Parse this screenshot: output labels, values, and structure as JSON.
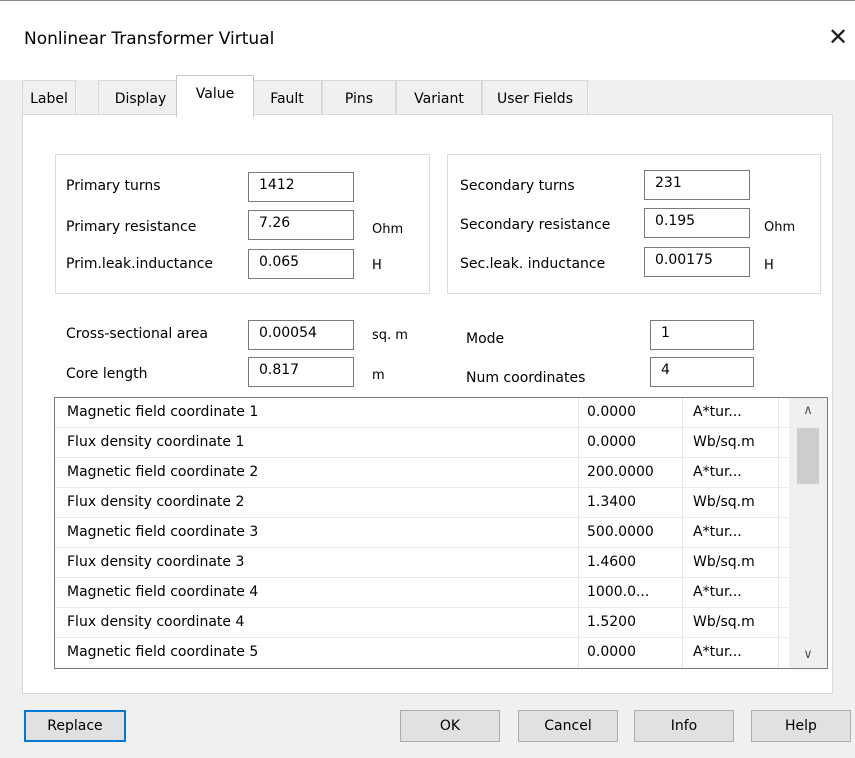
{
  "window": {
    "title": "Nonlinear Transformer Virtual",
    "close_glyph": "✕"
  },
  "tabs": [
    {
      "label": "Label"
    },
    {
      "label": "Display"
    },
    {
      "label": "Value"
    },
    {
      "label": "Fault"
    },
    {
      "label": "Pins"
    },
    {
      "label": "Variant"
    },
    {
      "label": "User Fields"
    }
  ],
  "active_tab": "Value",
  "primary": {
    "turns_label": "Primary turns",
    "turns_value": "1412",
    "resistance_label": "Primary resistance",
    "resistance_value": "7.26",
    "resistance_unit": "Ohm",
    "leak_label": "Prim.leak.inductance",
    "leak_value": "0.065",
    "leak_unit": "H"
  },
  "secondary": {
    "turns_label": "Secondary turns",
    "turns_value": "231",
    "resistance_label": "Secondary resistance",
    "resistance_value": "0.195",
    "resistance_unit": "Ohm",
    "leak_label": "Sec.leak. inductance",
    "leak_value": "0.00175",
    "leak_unit": "H"
  },
  "core": {
    "area_label": "Cross-sectional area",
    "area_value": "0.00054",
    "area_unit": "sq. m",
    "length_label": "Core length",
    "length_value": "0.817",
    "length_unit": "m",
    "mode_label": "Mode",
    "mode_value": "1",
    "numcoord_label": "Num coordinates",
    "numcoord_value": "4"
  },
  "coordinates": [
    {
      "name": "Magnetic field coordinate 1",
      "value": "0.0000",
      "unit": "A*tur..."
    },
    {
      "name": "Flux density coordinate 1",
      "value": "0.0000",
      "unit": "Wb/sq.m"
    },
    {
      "name": "Magnetic field coordinate 2",
      "value": "200.0000",
      "unit": "A*tur..."
    },
    {
      "name": "Flux density coordinate 2",
      "value": "1.3400",
      "unit": "Wb/sq.m"
    },
    {
      "name": "Magnetic field coordinate 3",
      "value": "500.0000",
      "unit": "A*tur..."
    },
    {
      "name": "Flux density coordinate 3",
      "value": "1.4600",
      "unit": "Wb/sq.m"
    },
    {
      "name": "Magnetic field coordinate 4",
      "value": "1000.0...",
      "unit": "A*tur..."
    },
    {
      "name": "Flux density coordinate 4",
      "value": "1.5200",
      "unit": "Wb/sq.m"
    },
    {
      "name": "Magnetic field coordinate 5",
      "value": "0.0000",
      "unit": "A*tur..."
    }
  ],
  "scrollbar": {
    "up_glyph": "∧",
    "down_glyph": "∨"
  },
  "buttons": {
    "replace": "Replace",
    "ok": "OK",
    "cancel": "Cancel",
    "info": "Info",
    "help": "Help"
  },
  "colors": {
    "accent": "#0078d7",
    "background": "#f0f0f0"
  }
}
